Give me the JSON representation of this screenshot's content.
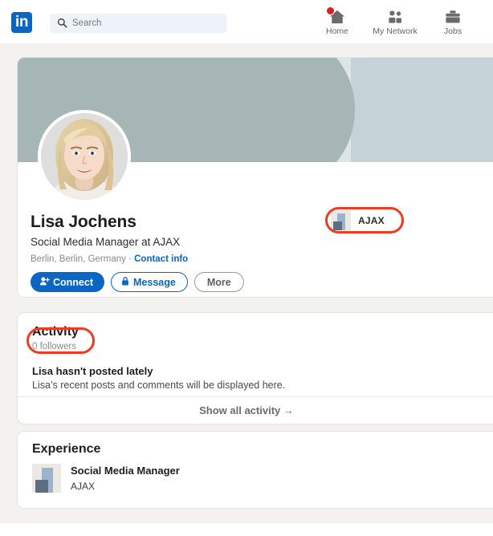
{
  "navbar": {
    "logo_text": "in",
    "search": {
      "placeholder": "Search",
      "value": "",
      "icon": "search-icon"
    },
    "items": [
      {
        "label": "Home",
        "icon": "home-icon",
        "badge": true
      },
      {
        "label": "My Network",
        "icon": "people-icon",
        "badge": false
      },
      {
        "label": "Jobs",
        "icon": "briefcase-icon",
        "badge": false
      }
    ]
  },
  "profile": {
    "name": "Lisa Jochens",
    "headline": "Social Media Manager at AJAX",
    "location": "Berlin, Berlin, Germany",
    "separator": "·",
    "contact_info_label": "Contact info",
    "avatar_alt": "profile-photo",
    "actions": [
      {
        "label": "Connect",
        "icon": "person-add-icon",
        "style": "primary"
      },
      {
        "label": "Message",
        "icon": "lock-icon",
        "style": "outline-blue"
      },
      {
        "label": "More",
        "icon": "",
        "style": "outline-gray"
      }
    ],
    "company_chip": {
      "name": "AJAX",
      "logo": "ajax-logo-icon"
    }
  },
  "activity": {
    "title": "Activity",
    "followers": "0 followers",
    "empty_title": "Lisa hasn't posted lately",
    "empty_subtitle": "Lisa’s recent posts and comments will be displayed here.",
    "show_all_label": "Show all activity →"
  },
  "experience": {
    "title": "Experience",
    "items": [
      {
        "role": "Social Media Manager",
        "company": "AJAX",
        "logo": "ajax-logo-icon"
      }
    ]
  },
  "annotations": {
    "color": "#ef3b21",
    "targets": [
      "company-chip",
      "activity-heading"
    ]
  },
  "theme": {
    "brand_blue": "#0a66c2",
    "page_bg": "#f4f2ee",
    "card_bg": "#ffffff",
    "cover_primary": "#a6b5b6",
    "cover_pale": "#dde5e5",
    "cover_blue": "#c5d3d6",
    "badge_red": "#e11d19"
  }
}
